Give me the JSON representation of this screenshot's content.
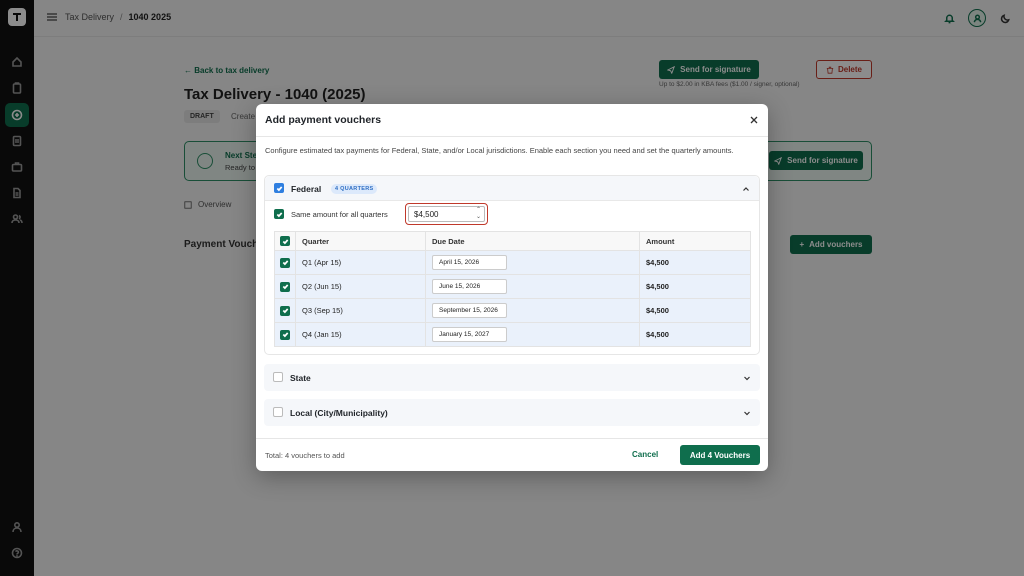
{
  "breadcrumb": {
    "parent": "Tax Delivery",
    "current": "1040 2025"
  },
  "page": {
    "back_link": "Back to tax delivery",
    "title": "Tax Delivery - 1040 (2025)",
    "status_badge": "DRAFT",
    "created_text": "Create",
    "send_signature": "Send for signature",
    "kba_note": "Up to $2.00 in KBA fees ($1.00 / signer, optional)",
    "delete": "Delete",
    "next_step_title": "Next Ste",
    "next_step_sub": "Ready to",
    "next_step_button": "Send for signature",
    "tab_overview": "Overview",
    "section_title": "Payment Vouch",
    "add_vouchers": "Add vouchers"
  },
  "modal": {
    "title": "Add payment vouchers",
    "description": "Configure estimated tax payments for Federal, State, and/or Local jurisdictions. Enable each section you need and set the quarterly amounts.",
    "federal": {
      "label": "Federal",
      "badge": "4 QUARTERS",
      "same_amount_label": "Same amount for all quarters",
      "amount_value": "$4,500",
      "columns": [
        "Quarter",
        "Due Date",
        "Amount"
      ],
      "rows": [
        {
          "quarter": "Q1 (Apr 15)",
          "due": "April 15, 2026",
          "amount": "$4,500"
        },
        {
          "quarter": "Q2 (Jun 15)",
          "due": "June 15, 2026",
          "amount": "$4,500"
        },
        {
          "quarter": "Q3 (Sep 15)",
          "due": "September 15, 2026",
          "amount": "$4,500"
        },
        {
          "quarter": "Q4 (Jan 15)",
          "due": "January 15, 2027",
          "amount": "$4,500"
        }
      ]
    },
    "state_label": "State",
    "local_label": "Local (City/Municipality)",
    "total_text": "Total: 4 vouchers to add",
    "cancel": "Cancel",
    "add_button": "Add 4 Vouchers"
  },
  "colors": {
    "brand": "#0f6e4d",
    "checkbox_blue": "#2f7fe0",
    "highlight": "#c0392b"
  }
}
